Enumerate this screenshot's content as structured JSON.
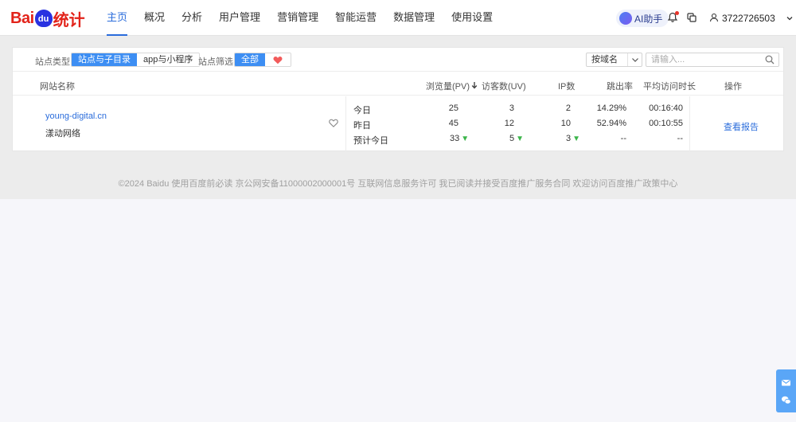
{
  "logo": {
    "bai": "Bai",
    "du": "du",
    "tongji": "统计"
  },
  "nav": {
    "items": [
      {
        "label": "主页",
        "active": true
      },
      {
        "label": "概况"
      },
      {
        "label": "分析"
      },
      {
        "label": "用户管理"
      },
      {
        "label": "营销管理"
      },
      {
        "label": "智能运营"
      },
      {
        "label": "数据管理"
      },
      {
        "label": "使用设置"
      }
    ],
    "ai_label": "AI助手",
    "username": "3722726503"
  },
  "filters": {
    "site_type_label": "站点类型:",
    "site_type_options": [
      "站点与子目录",
      "app与小程序"
    ],
    "site_filter_label": "站点筛选:",
    "site_filter_all": "全部",
    "search_by": "按域名",
    "search_placeholder": "请输入..."
  },
  "table": {
    "headers": {
      "site": "网站名称",
      "pv": "浏览量(PV)",
      "uv": "访客数(UV)",
      "ip": "IP数",
      "bounce": "跳出率",
      "avg_time": "平均访问时长",
      "ops": "操作"
    },
    "row": {
      "url": "young-digital.cn",
      "name": "漾动网络",
      "report_label": "查看报告",
      "periods": [
        {
          "label": "今日",
          "pv": "25",
          "uv": "3",
          "ip": "2",
          "bounce": "14.29%",
          "avg_time": "00:16:40"
        },
        {
          "label": "昨日",
          "pv": "45",
          "uv": "12",
          "ip": "10",
          "bounce": "52.94%",
          "avg_time": "00:10:55"
        },
        {
          "label": "预计今日",
          "pv": "33",
          "uv": "5",
          "ip": "3",
          "bounce": "--",
          "avg_time": "--"
        }
      ]
    }
  },
  "footer": "©2024 Baidu 使用百度前必读 京公网安备11000002000001号 互联网信息服务许可 我已阅读并接受百度推广服务合同 欢迎访问百度推广政策中心",
  "colors": {
    "accent": "#2a6cdb",
    "brand_red": "#e2231a",
    "down_green": "#3bb54a"
  }
}
